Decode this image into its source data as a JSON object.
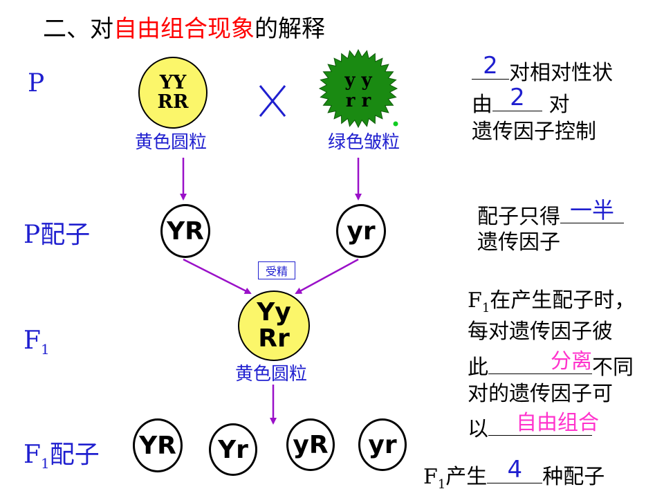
{
  "title": {
    "prefix": "二、对",
    "highlight": "自由组合现象",
    "suffix": "的解释"
  },
  "rows": {
    "p": "P",
    "p_gametes": "P配子",
    "f1_main": "F",
    "f1_sub": "1",
    "f1_gametes_main": "F",
    "f1_gametes_sub": "1",
    "f1_gametes_suffix": "配子"
  },
  "parents": {
    "yellow": {
      "genotype_line1": "YY",
      "genotype_line2": "RR",
      "label": "黄色圆粒"
    },
    "cross_symbol": "×",
    "green": {
      "genotype_line1": "y y",
      "genotype_line2": "r r",
      "label": "绿色皱粒"
    }
  },
  "p_gametes": [
    "YR",
    "yr"
  ],
  "fertilization_label": "受精",
  "f1": {
    "genotype_line1": "Yy",
    "genotype_line2": "Rr",
    "label": "黄色圆粒"
  },
  "f1_gametes": [
    "YR",
    "Yr",
    "yR",
    "yr"
  ],
  "notes": {
    "n1": {
      "blank1": "2",
      "t1": "对相对性状",
      "t2": "由",
      "blank2": "2",
      "t3": " 对",
      "t4": "遗传因子控制"
    },
    "n2": {
      "t1": "配子只得",
      "blank": "一半",
      "t2": "遗传因子"
    },
    "n3": {
      "t1_main": "F",
      "t1_sub": "1",
      "t1_rest": "在产生配子时，",
      "t2": "每对遗传因子彼",
      "t3": "此",
      "blank1": "分离",
      "t4": "不同",
      "t5": "对的遗传因子可",
      "t6": "以",
      "blank2": "自由组合"
    },
    "n4": {
      "t1_main": "F",
      "t1_sub": "1",
      "t1_rest": "产生",
      "blank": "4",
      "t2": "种配子"
    }
  },
  "colors": {
    "arrow": "#9a10c8",
    "yellow_fill": "#fbf66a",
    "green_fill": "#1a8a12",
    "label_blue": "#1f1fcf",
    "title_red": "#ff0000",
    "answer_magenta": "#ff33cc"
  }
}
